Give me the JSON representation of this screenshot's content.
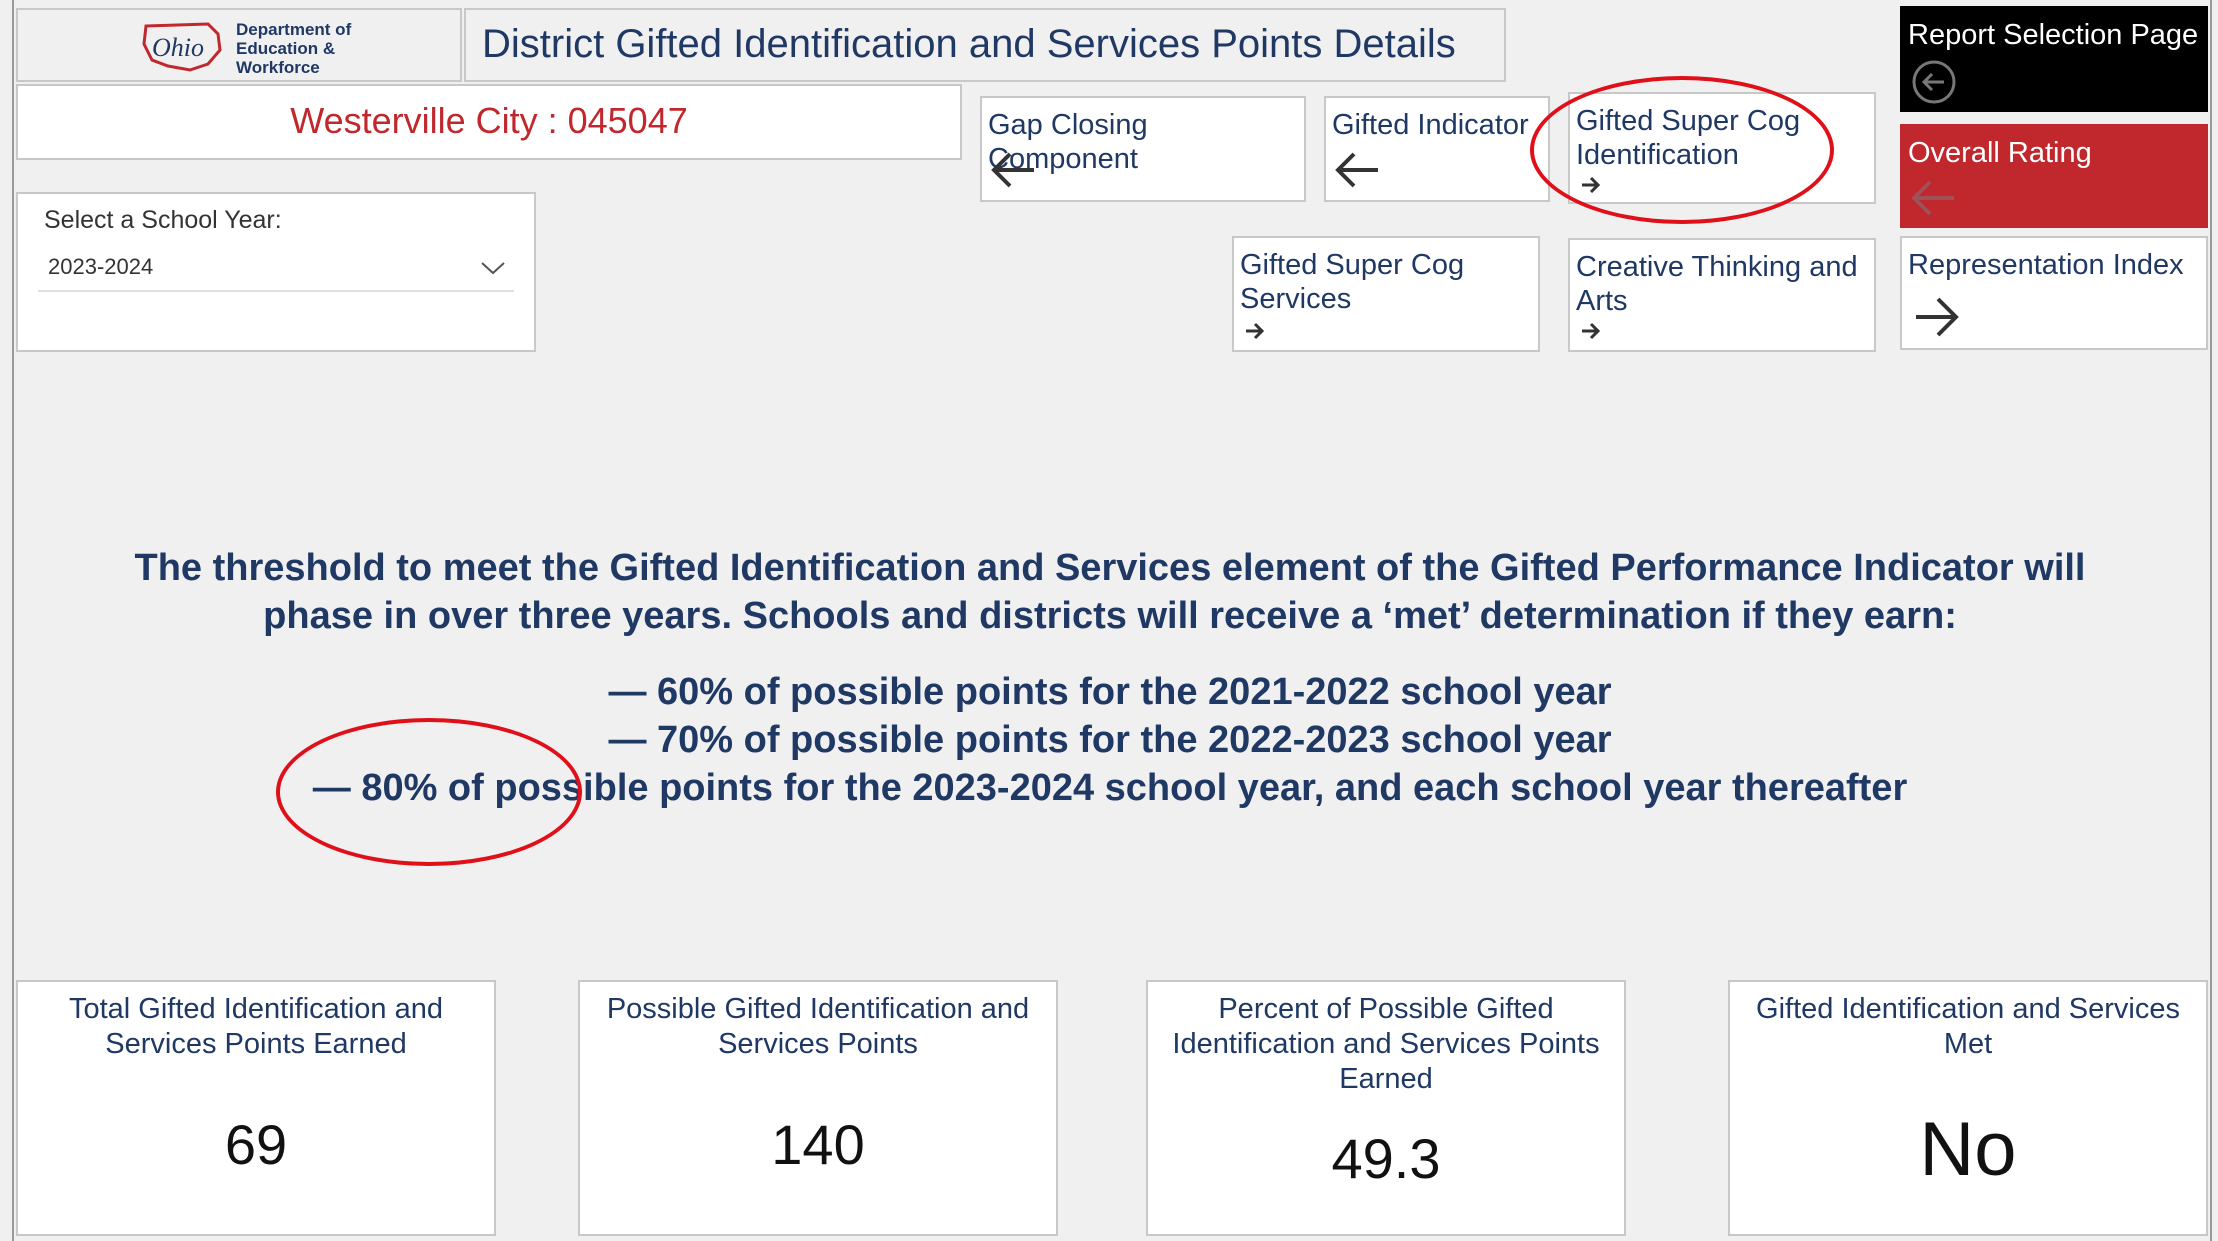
{
  "header": {
    "logo_lines": [
      "Department of",
      "Education &",
      "Workforce"
    ],
    "logo_script": "Ohio",
    "title": "District Gifted Identification and Services Points Details"
  },
  "district": {
    "name": "Westerville City : 045047"
  },
  "year_filter": {
    "label": "Select a School Year:",
    "value": "2023-2024"
  },
  "nav": {
    "gap_closing": "Gap Closing Component",
    "gifted_indicator": "Gifted Indicator",
    "super_cog_identification": "Gifted Super Cog Identification",
    "report_selection": "Report Selection Page",
    "overall_rating": "Overall Rating",
    "super_cog_services": "Gifted Super Cog Services",
    "creative_thinking": "Creative Thinking and Arts",
    "representation_index": "Representation Index"
  },
  "threshold": {
    "intro_line1": "The threshold to meet the Gifted Identification and Services element of the Gifted Performance Indicator will",
    "intro_line2": "phase in over three years. Schools and districts will receive a ‘met’ determination if they earn:",
    "bullet1": "— 60% of possible points for the 2021-2022 school year",
    "bullet2": "— 70% of possible points for the 2022-2023 school year",
    "bullet3": "— 80% of possible points for the 2023-2024 school year, and each school year thereafter"
  },
  "cards": [
    {
      "title": "Total Gifted Identification and Services Points Earned",
      "value": "69"
    },
    {
      "title": "Possible Gifted Identification and Services Points",
      "value": "140"
    },
    {
      "title": "Percent of Possible Gifted Identification and Services Points Earned",
      "value": "49.3"
    },
    {
      "title": "Gifted Identification and Services Met",
      "value": "No"
    }
  ],
  "colors": {
    "navy": "#1f3864",
    "accent_red": "#c0282e",
    "annotation": "#e0101a"
  },
  "icons": {
    "back": "arrow-left-icon",
    "drill": "arrow-right-icon",
    "home": "circle-arrow-left-icon"
  }
}
